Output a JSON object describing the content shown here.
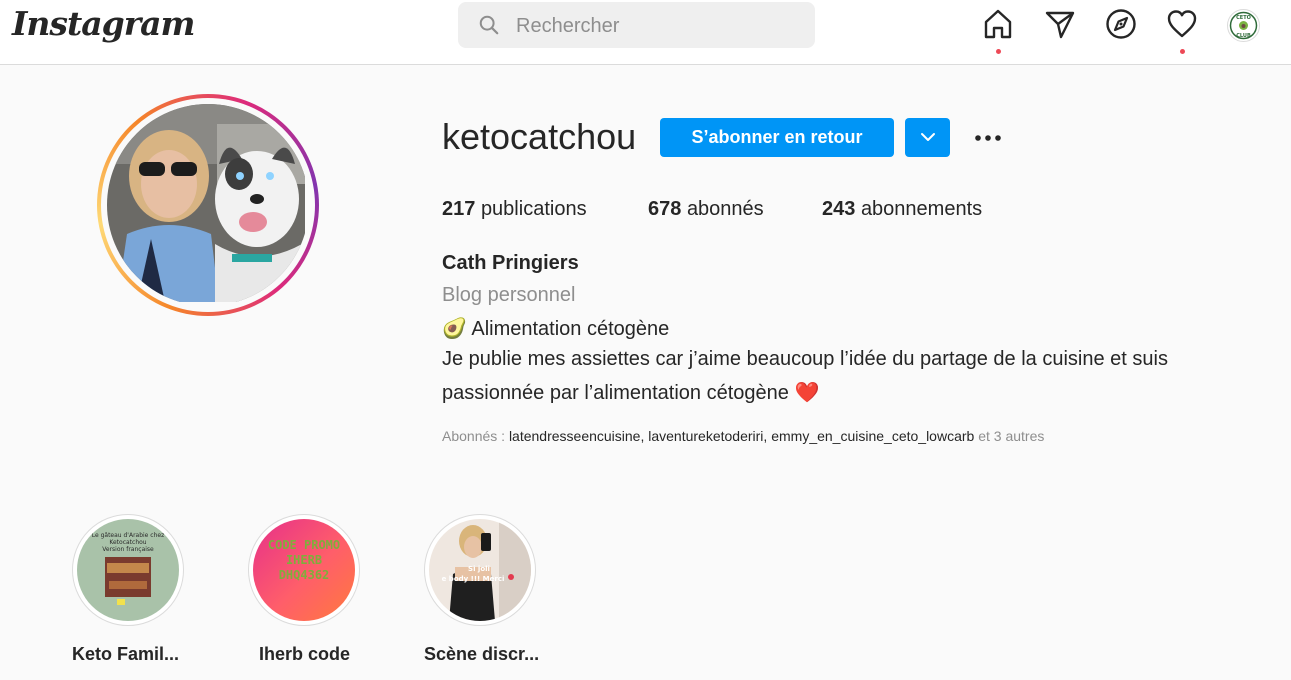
{
  "nav": {
    "logo": "Instagram",
    "search_placeholder": "Rechercher",
    "avatar_text": "CETO CLUB"
  },
  "profile": {
    "username": "ketocatchou",
    "follow_button": "S’abonner en retour",
    "stats": [
      {
        "count": "217",
        "label": "publications"
      },
      {
        "count": "678",
        "label": "abonnés"
      },
      {
        "count": "243",
        "label": "abonnements"
      }
    ],
    "full_name": "Cath Pringiers",
    "category": "Blog personnel",
    "bio": {
      "line1_emoji": "🥑",
      "line1": "Alimentation cétogène",
      "line2": "Je publie mes assiettes car j’aime beaucoup l’idée du partage de la cuisine et suis",
      "line3": "passionnée par l’alimentation cétogène",
      "line3_emoji": "❤️"
    },
    "followed_by": {
      "prefix": "Abonnés : ",
      "accounts": [
        "latendresseencuisine",
        "laventureketoderiri",
        "emmy_en_cuisine_ceto_lowcarb"
      ],
      "separator": ", ",
      "suffix": " et 3 autres"
    }
  },
  "highlights": [
    {
      "label": "Keto Famil...",
      "overlay_text": "Le gâteau d'Arabie chez Ketocatchou Version française"
    },
    {
      "label": "Iherb code",
      "overlay_text": "CODE PROMO IHERB DHQ4362"
    },
    {
      "label": "Scène discr...",
      "overlay_text": "Si joli e body !!! Merci"
    }
  ],
  "colors": {
    "primary_blue": "#0095f6",
    "notification_red": "#ed4956",
    "text": "#262626",
    "muted": "#8e8e8e"
  }
}
